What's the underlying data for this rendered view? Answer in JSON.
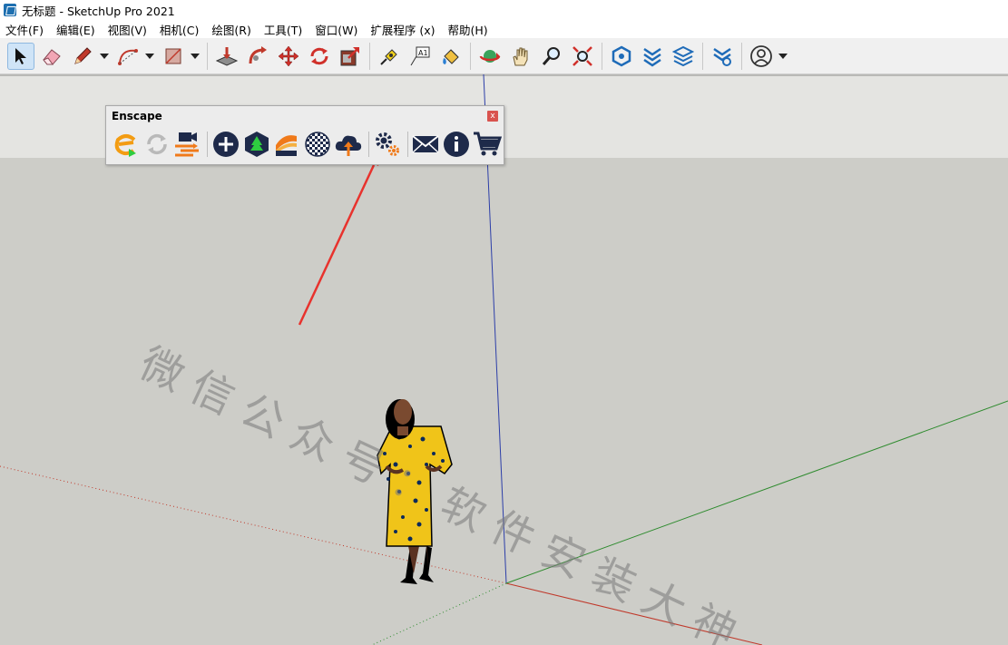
{
  "window": {
    "title": "无标题 - SketchUp Pro 2021"
  },
  "menu": [
    "文件(F)",
    "编辑(E)",
    "视图(V)",
    "相机(C)",
    "绘图(R)",
    "工具(T)",
    "窗口(W)",
    "扩展程序 (x)",
    "帮助(H)"
  ],
  "toolbar": {
    "icons": [
      "select-icon",
      "eraser-icon",
      "pencil-icon",
      "arc-icon",
      "rectangle-icon",
      "push-pull-icon",
      "follow-me-icon",
      "move-icon",
      "rotate-icon",
      "scale-icon",
      "tape-measure-icon",
      "text-icon",
      "paint-bucket-icon",
      "orbit-icon",
      "pan-icon",
      "zoom-icon",
      "zoom-extents-icon",
      "warehouse-icon",
      "extension-warehouse-icon",
      "layout-icon",
      "extension-manager-icon",
      "profile-icon"
    ]
  },
  "enscape": {
    "title": "Enscape",
    "close_label": "x",
    "buttons": [
      "start-enscape",
      "live-updates",
      "video-editor",
      "capture",
      "asset-library",
      "material-editor",
      "panorama",
      "upload",
      "settings",
      "feedback",
      "about",
      "shop"
    ]
  },
  "watermark": {
    "text": "微信公众号：软件安装大神"
  },
  "colors": {
    "axis_red": "#c0392b",
    "axis_green": "#2e8b2e",
    "axis_blue": "#2c3ea8",
    "arrow": "#e8322d"
  }
}
